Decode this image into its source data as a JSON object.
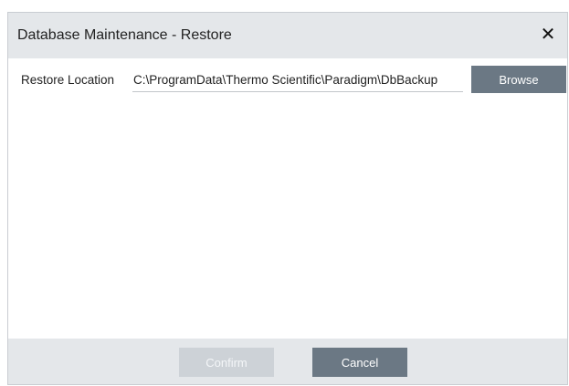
{
  "dialog": {
    "title": "Database Maintenance - Restore",
    "close_icon": "close-icon"
  },
  "restore": {
    "label": "Restore Location",
    "path_value": "C:\\ProgramData\\Thermo Scientific\\Paradigm\\DbBackup",
    "browse_label": "Browse"
  },
  "footer": {
    "confirm_label": "Confirm",
    "confirm_enabled": false,
    "cancel_label": "Cancel"
  },
  "colors": {
    "header_bg": "#e4e7ea",
    "button_bg": "#6b7884",
    "button_disabled_bg": "#cdd2d7"
  }
}
